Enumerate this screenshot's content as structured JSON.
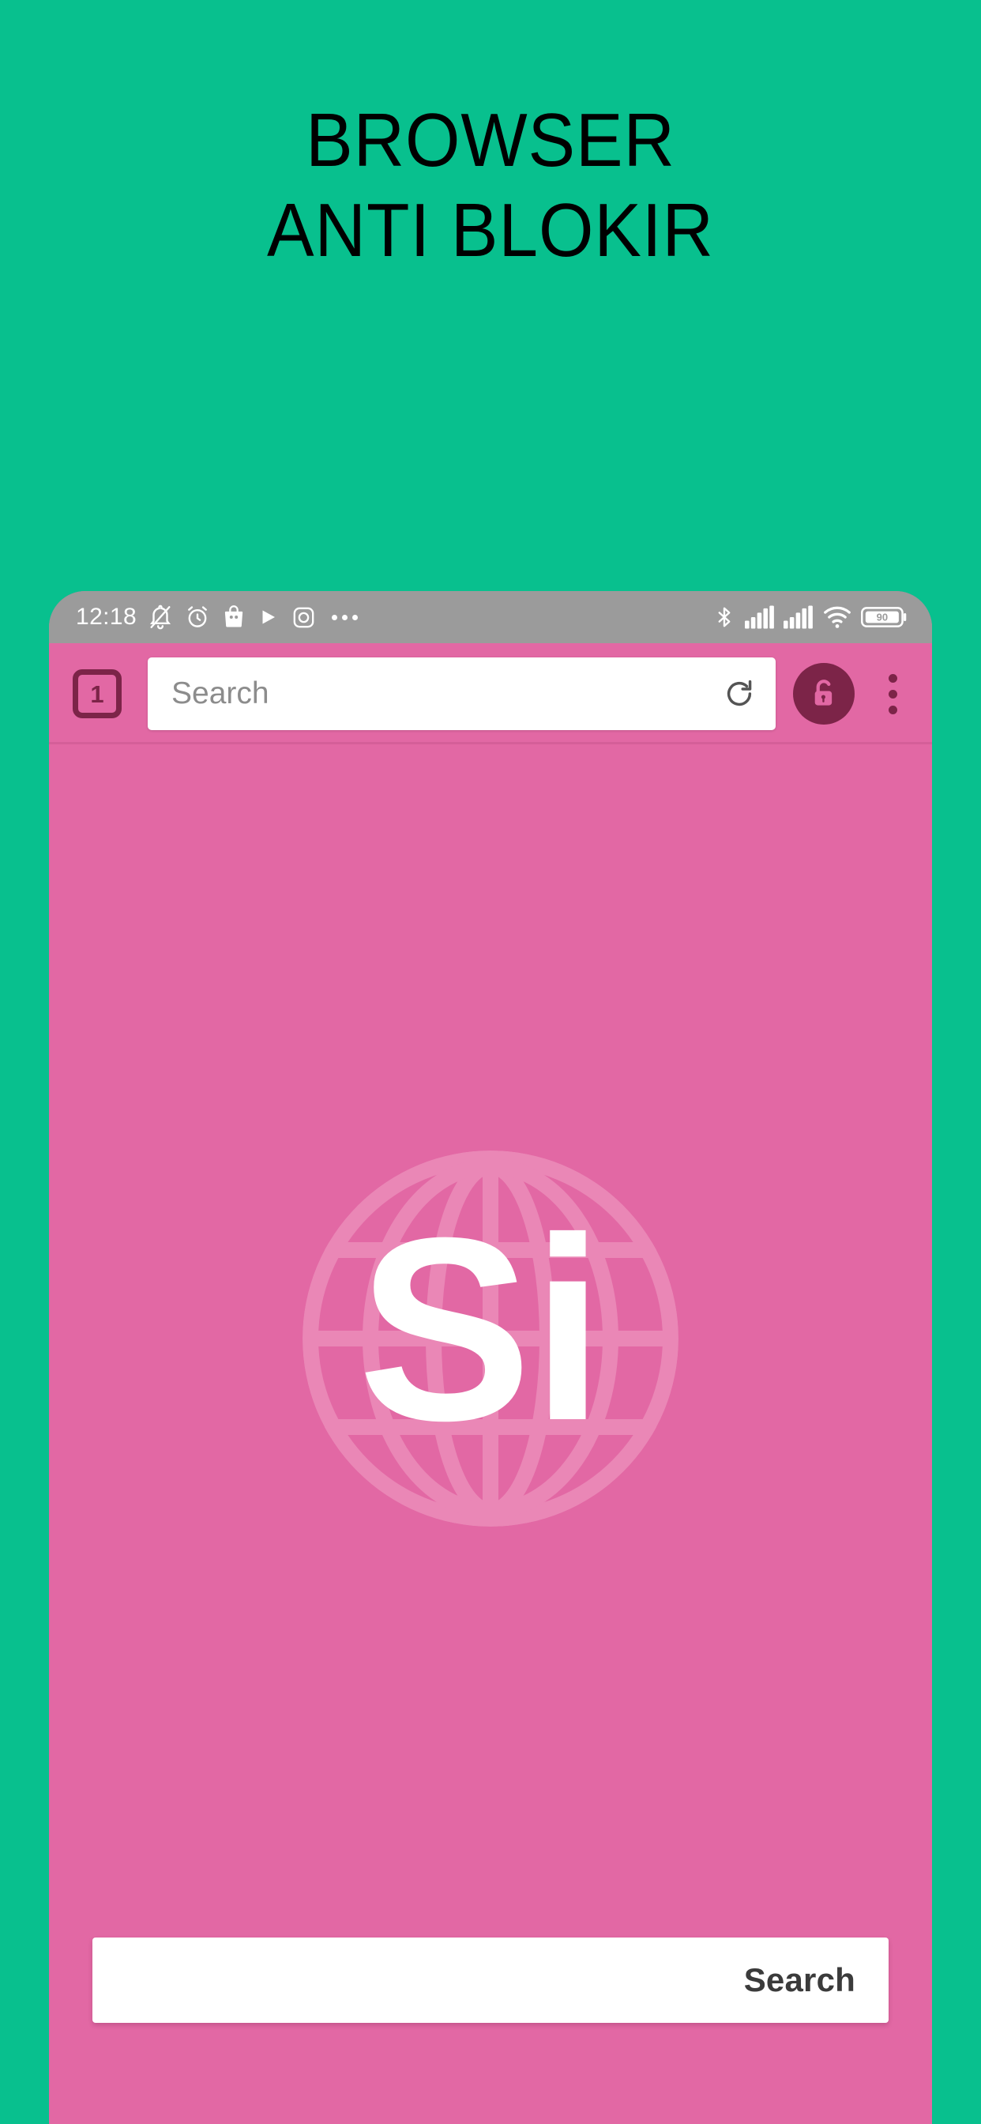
{
  "promo": {
    "title_line_1": "BROWSER",
    "title_line_2": "ANTI BLOKIR",
    "background_color": "#08c08e",
    "title_color": "#000000"
  },
  "phone": {
    "status_bar": {
      "clock": "12:18",
      "background_color": "#9b9b9b",
      "left_icons": [
        "notification-muted-icon",
        "alarm-clock-icon",
        "shopping-bag-icon",
        "play-store-icon",
        "instagram-icon",
        "more-status-icons"
      ],
      "right_icons": [
        "bluetooth-icon",
        "signal-sim1-icon",
        "signal-sim2-icon",
        "wifi-icon",
        "battery-icon"
      ],
      "battery_level": "90"
    },
    "browser": {
      "accent_color": "#e268a4",
      "control_color": "#7c2448",
      "tab_count": "1",
      "omnibox_placeholder": "Search",
      "omnibox_value": "",
      "reload_label": "reload-icon",
      "unlock_label": "unlock-icon",
      "menu_label": "overflow-menu-icon"
    },
    "content": {
      "logo_letters": "Si",
      "logo_background": "#e268a4",
      "search_button_label": "Search",
      "search_input_value": "",
      "search_input_placeholder": ""
    }
  }
}
